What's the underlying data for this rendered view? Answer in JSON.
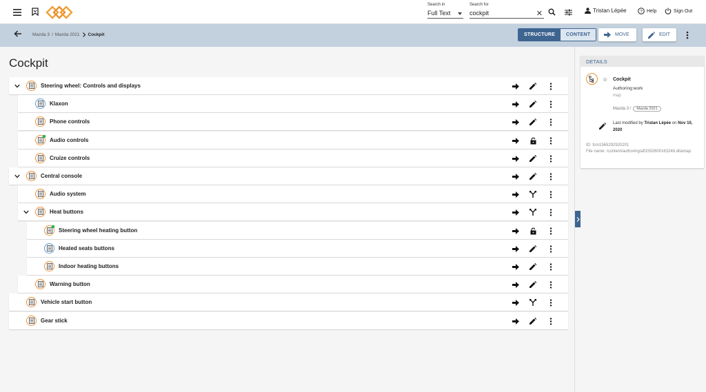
{
  "topbar": {
    "search_in_label": "Search in",
    "search_in_value": "Full Text",
    "search_for_label": "Search for",
    "search_for_value": "cockpit",
    "user_name": "Tristan Lépée",
    "help_label": "Help",
    "signout_label": "Sign Out"
  },
  "subbar": {
    "breadcrumb": [
      "Mazda 3",
      "/",
      "Mazda 2021",
      "Cockpit"
    ],
    "structure_label": "STRUCTURE",
    "content_label": "CONTENT",
    "move_label": "MOVE",
    "edit_label": "EDIT"
  },
  "page_title": "Cockpit",
  "tree": [
    {
      "label": "Steering wheel: Controls and displays",
      "level": 0,
      "expandable": true,
      "icon_color": "orange",
      "new_dot": false,
      "mid_action": "edit"
    },
    {
      "label": "Klaxon",
      "level": 1,
      "expandable": false,
      "icon_color": "blue",
      "new_dot": false,
      "mid_action": "edit"
    },
    {
      "label": "Phone controls",
      "level": 1,
      "expandable": false,
      "icon_color": "orange",
      "new_dot": false,
      "mid_action": "edit"
    },
    {
      "label": "Audio controls",
      "level": 1,
      "expandable": false,
      "icon_color": "orange",
      "new_dot": true,
      "mid_action": "lock"
    },
    {
      "label": "Cruize controls",
      "level": 1,
      "expandable": false,
      "icon_color": "orange",
      "new_dot": false,
      "mid_action": "edit"
    },
    {
      "label": "Central console",
      "level": 0,
      "expandable": true,
      "icon_color": "orange",
      "new_dot": false,
      "mid_action": "edit"
    },
    {
      "label": "Audio system",
      "level": 1,
      "expandable": false,
      "icon_color": "orange",
      "new_dot": false,
      "mid_action": "merge"
    },
    {
      "label": "Heat buttons",
      "level": 1,
      "expandable": true,
      "icon_color": "orange",
      "new_dot": false,
      "mid_action": "merge"
    },
    {
      "label": "Steering wheel heating button",
      "level": 2,
      "expandable": false,
      "icon_color": "orange",
      "new_dot": true,
      "mid_action": "lock"
    },
    {
      "label": "Heated seats buttons",
      "level": 2,
      "expandable": false,
      "icon_color": "blue",
      "new_dot": false,
      "mid_action": "edit"
    },
    {
      "label": "Indoor heating buttons",
      "level": 2,
      "expandable": false,
      "icon_color": "orange",
      "new_dot": false,
      "mid_action": "edit"
    },
    {
      "label": "Warning button",
      "level": 1,
      "expandable": false,
      "icon_color": "orange",
      "new_dot": false,
      "mid_action": "edit"
    },
    {
      "label": "Vehicle start button",
      "level": 0,
      "expandable": false,
      "icon_color": "orange",
      "new_dot": false,
      "mid_action": "merge"
    },
    {
      "label": "Gear stick",
      "level": 0,
      "expandable": false,
      "icon_color": "orange",
      "new_dot": false,
      "mid_action": "edit"
    }
  ],
  "details": {
    "header": "DETAILS",
    "name": "Cockpit",
    "type": "Authoring:work",
    "subtype": "map",
    "path_prefix": "Mazda 3 /",
    "path_chip": "Mazda 2021",
    "modified_prefix": "Last modified by",
    "modified_user": "Tristan Lépée",
    "modified_on": "on",
    "modified_date": "Nov 10, 2020",
    "id_line": "ID: fcm1565292920201",
    "file_line": "File name: /content/authoring/afl1592600163248.ditamap"
  },
  "colors": {
    "accent": "#3e6590",
    "subbar": "#c3d0de",
    "icon_orange": "#e8913a",
    "icon_blue": "#5b9bd5",
    "new_dot": "#2bb44a"
  }
}
